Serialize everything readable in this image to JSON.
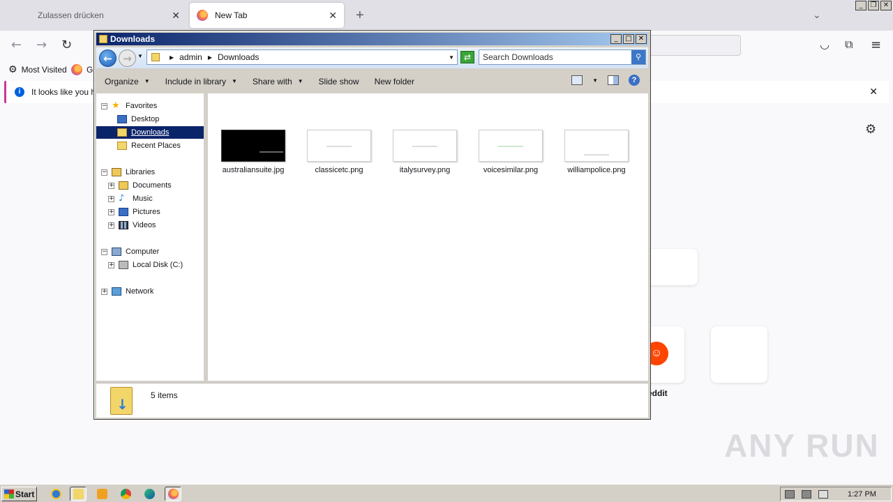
{
  "browser": {
    "tabs": [
      {
        "label": "Zulassen drücken",
        "active": false
      },
      {
        "label": "New Tab",
        "active": true
      }
    ],
    "new_tab_glyph": "+",
    "bookmarks": [
      {
        "label": "Most Visited",
        "icon": "gear-icon"
      },
      {
        "label": "Ge",
        "icon": "firefox-icon"
      }
    ],
    "notice_text": "It looks like you ha",
    "shortcut_label": "eddit"
  },
  "explorer": {
    "title": "Downloads",
    "breadcrumb": [
      "admin",
      "Downloads"
    ],
    "search_placeholder": "Search Downloads",
    "commands": [
      {
        "label": "Organize",
        "has_menu": true
      },
      {
        "label": "Include in library",
        "has_menu": true
      },
      {
        "label": "Share with",
        "has_menu": true
      },
      {
        "label": "Slide show",
        "has_menu": false
      },
      {
        "label": "New folder",
        "has_menu": false
      }
    ],
    "tree": {
      "favorites": "Favorites",
      "desktop": "Desktop",
      "downloads": "Downloads",
      "recent": "Recent Places",
      "libraries": "Libraries",
      "documents": "Documents",
      "music": "Music",
      "pictures": "Pictures",
      "videos": "Videos",
      "computer": "Computer",
      "localdisk": "Local Disk (C:)",
      "network": "Network"
    },
    "files": [
      {
        "name": "australiansuite.jpg",
        "dark": true
      },
      {
        "name": "classicetc.png",
        "dark": false
      },
      {
        "name": "italysurvey.png",
        "dark": false
      },
      {
        "name": "voicesimilar.png",
        "dark": false
      },
      {
        "name": "williampolice.png",
        "dark": false
      }
    ],
    "item_count": "5 items"
  },
  "taskbar": {
    "start_label": "Start",
    "clock": "1:27 PM"
  },
  "watermark": "ANY RUN",
  "colors": {
    "title_gradient_start": "#0a246a",
    "selection": "#0a246a",
    "classic_face": "#d4d0c8"
  }
}
